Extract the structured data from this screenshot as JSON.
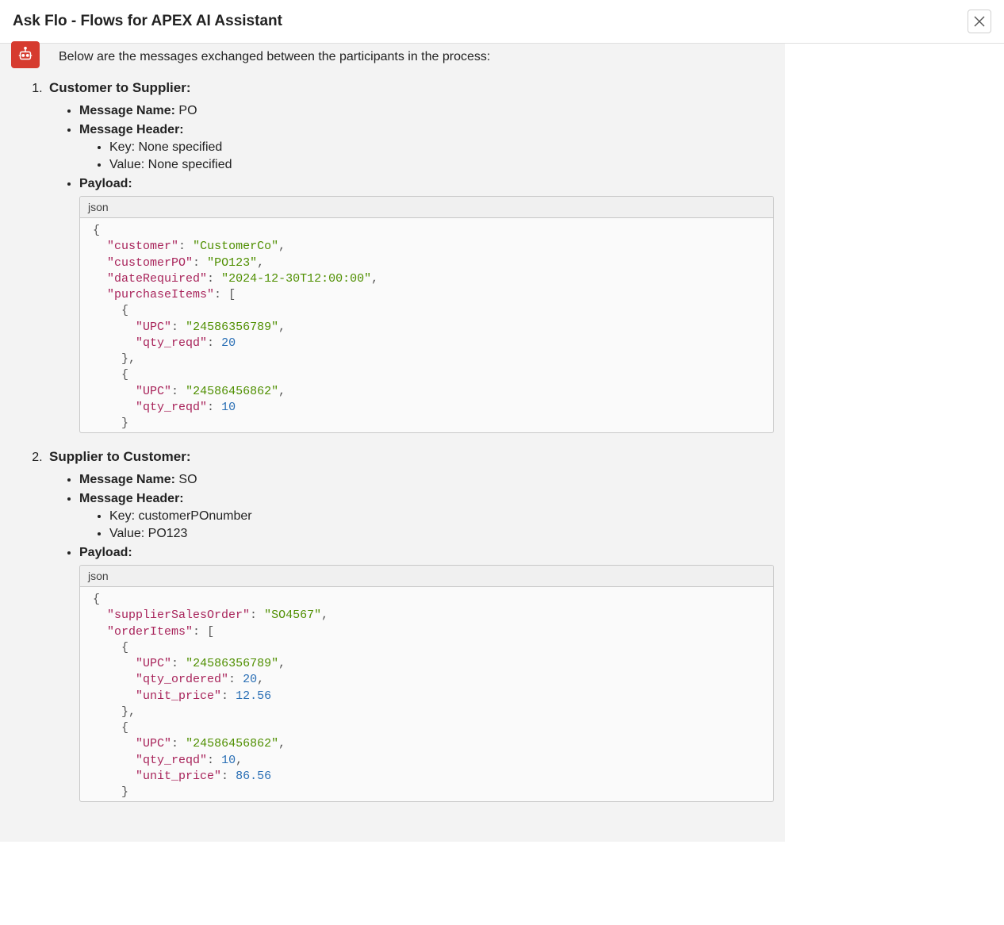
{
  "header": {
    "title": "Ask Flo - Flows for APEX AI Assistant"
  },
  "intro": "Below are the messages exchanged between the participants in the process:",
  "labels": {
    "msgName": "Message Name:",
    "msgHeader": "Message Header:",
    "payload": "Payload:",
    "key": "Key:",
    "value": "Value:",
    "lang": "json"
  },
  "messages": [
    {
      "title": "Customer to Supplier:",
      "name": "PO",
      "headerKey": "None specified",
      "headerValue": "None specified",
      "payload": {
        "customer": "CustomerCo",
        "customerPO": "PO123",
        "dateRequired": "2024-12-30T12:00:00",
        "purchaseItems": [
          {
            "UPC": "24586356789",
            "qty_reqd": 20
          },
          {
            "UPC": "24586456862",
            "qty_reqd": 10
          }
        ]
      }
    },
    {
      "title": "Supplier to Customer:",
      "name": "SO",
      "headerKey": "customerPOnumber",
      "headerValue": "PO123",
      "payload": {
        "supplierSalesOrder": "SO4567",
        "orderItems": [
          {
            "UPC": "24586356789",
            "qty_ordered": 20,
            "unit_price": 12.56
          },
          {
            "UPC": "24586456862",
            "qty_reqd": 10,
            "unit_price": 86.56
          }
        ]
      }
    }
  ]
}
